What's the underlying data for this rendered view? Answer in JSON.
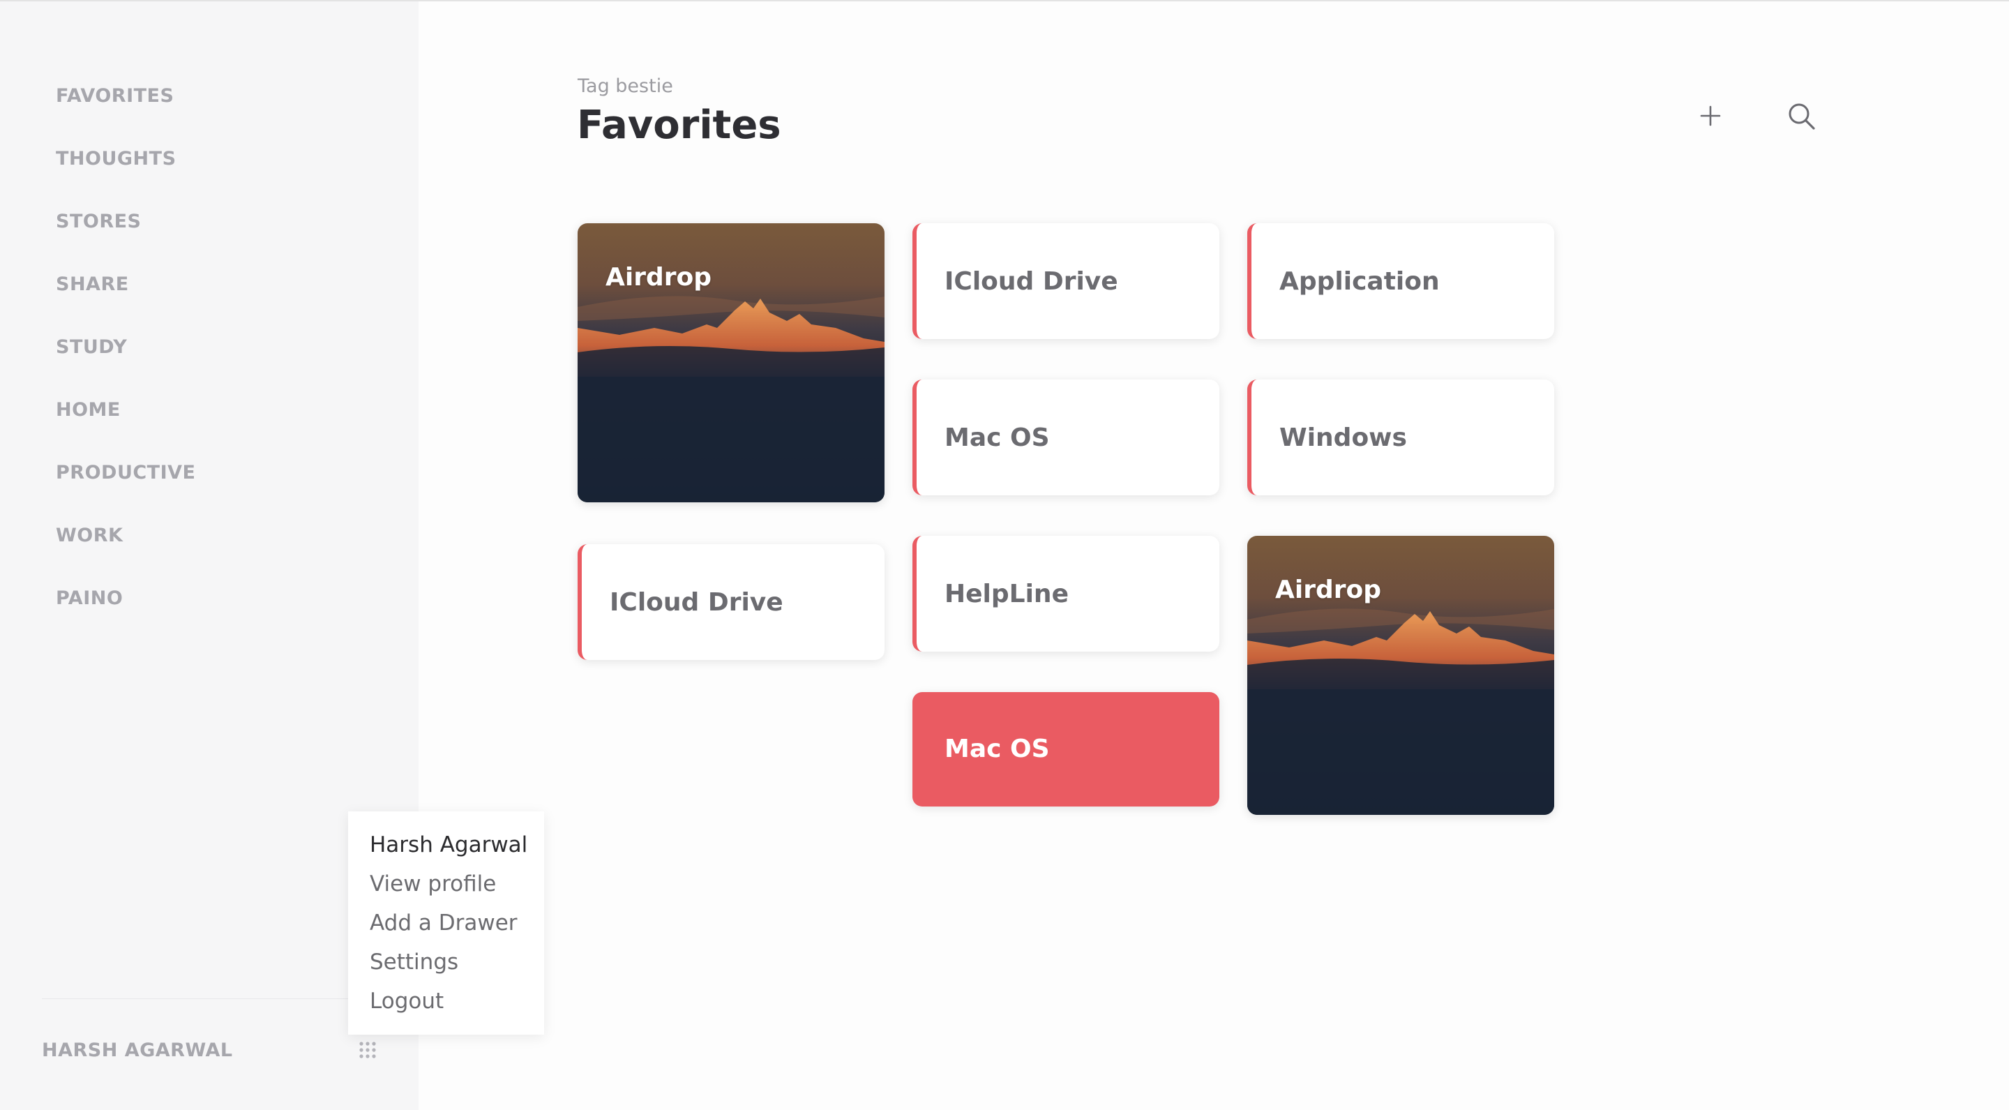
{
  "sidebar": {
    "items": [
      {
        "label": "FAVORITES"
      },
      {
        "label": "THOUGHTS"
      },
      {
        "label": "STORES"
      },
      {
        "label": "SHARE"
      },
      {
        "label": "STUDY"
      },
      {
        "label": "HOME"
      },
      {
        "label": "PRODUCTIVE"
      },
      {
        "label": "WORK"
      },
      {
        "label": "PAINO"
      }
    ],
    "user_name": "HARSH AGARWAL",
    "menu_icon": "grid-dots-icon"
  },
  "user_menu": {
    "name": "Harsh Agarwal",
    "items": [
      "View profile",
      "Add a Drawer",
      "Settings",
      "Logout"
    ]
  },
  "header": {
    "subtitle": "Tag bestie",
    "title": "Favorites",
    "actions": [
      "plus-icon",
      "search-icon"
    ]
  },
  "cards": [
    {
      "label": "Airdrop",
      "style": "image"
    },
    {
      "label": "ICloud Drive",
      "style": "white"
    },
    {
      "label": "Application",
      "style": "white"
    },
    {
      "label": "Mac OS",
      "style": "white"
    },
    {
      "label": "Windows",
      "style": "white"
    },
    {
      "label": "ICloud Drive",
      "style": "white"
    },
    {
      "label": "HelpLine",
      "style": "white"
    },
    {
      "label": "Airdrop",
      "style": "image"
    },
    {
      "label": "Mac OS",
      "style": "red"
    }
  ],
  "colors": {
    "accent": "#ea5b62",
    "sidebar_bg": "#f6f6f7",
    "nav_text": "#a6a6ac",
    "title_text": "#2e2e33",
    "card_text": "#6b6b70"
  }
}
